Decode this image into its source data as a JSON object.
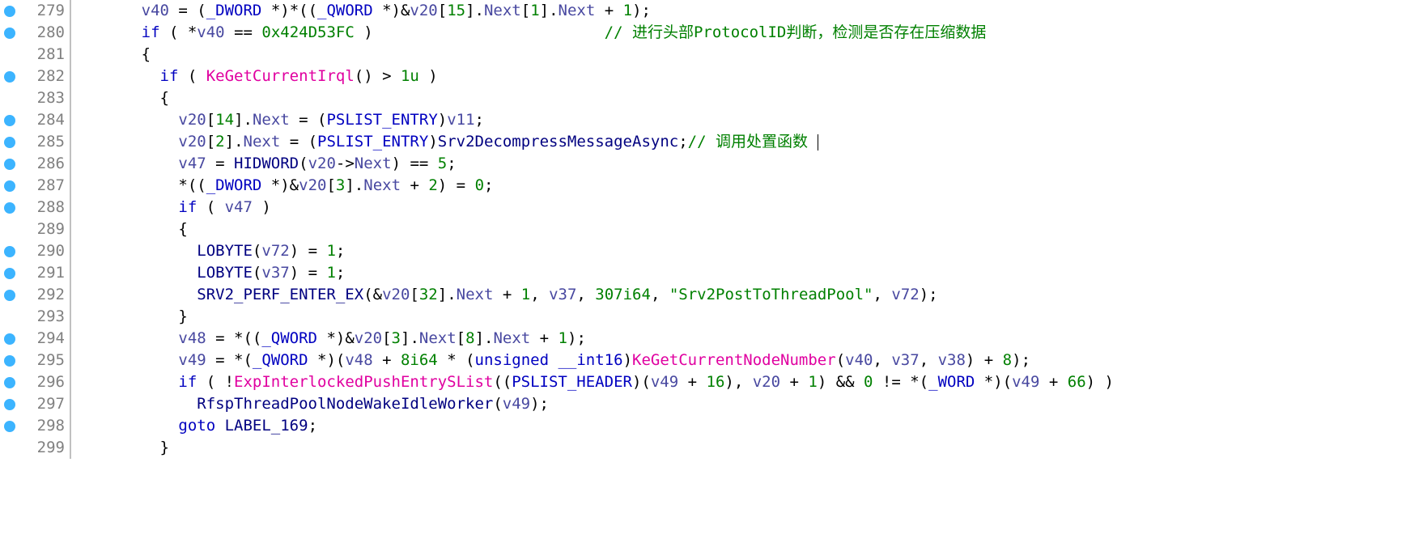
{
  "lines": [
    {
      "n": 279,
      "bp": true,
      "indent": 3,
      "segments": [
        {
          "c": "c-var",
          "t": "v40"
        },
        {
          "c": "c-plain",
          "t": " = ("
        },
        {
          "c": "c-type",
          "t": "_DWORD"
        },
        {
          "c": "c-plain",
          "t": " *)*(("
        },
        {
          "c": "c-type",
          "t": "_QWORD"
        },
        {
          "c": "c-plain",
          "t": " *)&"
        },
        {
          "c": "c-var",
          "t": "v20"
        },
        {
          "c": "c-plain",
          "t": "["
        },
        {
          "c": "c-num",
          "t": "15"
        },
        {
          "c": "c-plain",
          "t": "]."
        },
        {
          "c": "c-member",
          "t": "Next"
        },
        {
          "c": "c-plain",
          "t": "["
        },
        {
          "c": "c-num",
          "t": "1"
        },
        {
          "c": "c-plain",
          "t": "]."
        },
        {
          "c": "c-member",
          "t": "Next"
        },
        {
          "c": "c-plain",
          "t": " + "
        },
        {
          "c": "c-num",
          "t": "1"
        },
        {
          "c": "c-plain",
          "t": ");"
        }
      ]
    },
    {
      "n": 280,
      "bp": true,
      "indent": 3,
      "segments": [
        {
          "c": "c-kw",
          "t": "if"
        },
        {
          "c": "c-plain",
          "t": " ( *"
        },
        {
          "c": "c-var",
          "t": "v40"
        },
        {
          "c": "c-plain",
          "t": " == "
        },
        {
          "c": "c-num",
          "t": "0x424D53FC"
        },
        {
          "c": "c-plain",
          "t": " )                         "
        },
        {
          "c": "c-cmt",
          "t": "// 进行头部ProtocolID判断，检测是否存在压缩数据"
        }
      ]
    },
    {
      "n": 281,
      "bp": false,
      "indent": 3,
      "segments": [
        {
          "c": "c-plain",
          "t": "{"
        }
      ]
    },
    {
      "n": 282,
      "bp": true,
      "indent": 4,
      "segments": [
        {
          "c": "c-kw",
          "t": "if"
        },
        {
          "c": "c-plain",
          "t": " ( "
        },
        {
          "c": "c-lib",
          "t": "KeGetCurrentIrql"
        },
        {
          "c": "c-plain",
          "t": "() > "
        },
        {
          "c": "c-num",
          "t": "1u"
        },
        {
          "c": "c-plain",
          "t": " )"
        }
      ]
    },
    {
      "n": 283,
      "bp": false,
      "indent": 4,
      "segments": [
        {
          "c": "c-plain",
          "t": "{"
        }
      ]
    },
    {
      "n": 284,
      "bp": true,
      "indent": 5,
      "segments": [
        {
          "c": "c-var",
          "t": "v20"
        },
        {
          "c": "c-plain",
          "t": "["
        },
        {
          "c": "c-num",
          "t": "14"
        },
        {
          "c": "c-plain",
          "t": "]."
        },
        {
          "c": "c-member",
          "t": "Next"
        },
        {
          "c": "c-plain",
          "t": " = ("
        },
        {
          "c": "c-type",
          "t": "PSLIST_ENTRY"
        },
        {
          "c": "c-plain",
          "t": ")"
        },
        {
          "c": "c-var",
          "t": "v11"
        },
        {
          "c": "c-plain",
          "t": ";"
        }
      ]
    },
    {
      "n": 285,
      "bp": true,
      "indent": 5,
      "segments": [
        {
          "c": "c-var",
          "t": "v20"
        },
        {
          "c": "c-plain",
          "t": "["
        },
        {
          "c": "c-num",
          "t": "2"
        },
        {
          "c": "c-plain",
          "t": "]."
        },
        {
          "c": "c-member",
          "t": "Next"
        },
        {
          "c": "c-plain",
          "t": " = ("
        },
        {
          "c": "c-type",
          "t": "PSLIST_ENTRY"
        },
        {
          "c": "c-plain",
          "t": ")"
        },
        {
          "c": "c-func",
          "t": "Srv2DecompressMessageAsync"
        },
        {
          "c": "c-plain",
          "t": ";"
        },
        {
          "c": "c-cmt",
          "t": "// 调用处置函数 "
        },
        {
          "c": "cursor",
          "t": ""
        }
      ]
    },
    {
      "n": 286,
      "bp": true,
      "indent": 5,
      "segments": [
        {
          "c": "c-var",
          "t": "v47"
        },
        {
          "c": "c-plain",
          "t": " = "
        },
        {
          "c": "c-func",
          "t": "HIDWORD"
        },
        {
          "c": "c-plain",
          "t": "("
        },
        {
          "c": "c-var",
          "t": "v20"
        },
        {
          "c": "c-plain",
          "t": "->"
        },
        {
          "c": "c-member",
          "t": "Next"
        },
        {
          "c": "c-plain",
          "t": ") == "
        },
        {
          "c": "c-num",
          "t": "5"
        },
        {
          "c": "c-plain",
          "t": ";"
        }
      ]
    },
    {
      "n": 287,
      "bp": true,
      "indent": 5,
      "segments": [
        {
          "c": "c-plain",
          "t": "*(("
        },
        {
          "c": "c-type",
          "t": "_DWORD"
        },
        {
          "c": "c-plain",
          "t": " *)&"
        },
        {
          "c": "c-var",
          "t": "v20"
        },
        {
          "c": "c-plain",
          "t": "["
        },
        {
          "c": "c-num",
          "t": "3"
        },
        {
          "c": "c-plain",
          "t": "]."
        },
        {
          "c": "c-member",
          "t": "Next"
        },
        {
          "c": "c-plain",
          "t": " + "
        },
        {
          "c": "c-num",
          "t": "2"
        },
        {
          "c": "c-plain",
          "t": ") = "
        },
        {
          "c": "c-num",
          "t": "0"
        },
        {
          "c": "c-plain",
          "t": ";"
        }
      ]
    },
    {
      "n": 288,
      "bp": true,
      "indent": 5,
      "segments": [
        {
          "c": "c-kw",
          "t": "if"
        },
        {
          "c": "c-plain",
          "t": " ( "
        },
        {
          "c": "c-var",
          "t": "v47"
        },
        {
          "c": "c-plain",
          "t": " )"
        }
      ]
    },
    {
      "n": 289,
      "bp": false,
      "indent": 5,
      "segments": [
        {
          "c": "c-plain",
          "t": "{"
        }
      ]
    },
    {
      "n": 290,
      "bp": true,
      "indent": 6,
      "segments": [
        {
          "c": "c-func",
          "t": "LOBYTE"
        },
        {
          "c": "c-plain",
          "t": "("
        },
        {
          "c": "c-var",
          "t": "v72"
        },
        {
          "c": "c-plain",
          "t": ") = "
        },
        {
          "c": "c-num",
          "t": "1"
        },
        {
          "c": "c-plain",
          "t": ";"
        }
      ]
    },
    {
      "n": 291,
      "bp": true,
      "indent": 6,
      "segments": [
        {
          "c": "c-func",
          "t": "LOBYTE"
        },
        {
          "c": "c-plain",
          "t": "("
        },
        {
          "c": "c-var",
          "t": "v37"
        },
        {
          "c": "c-plain",
          "t": ") = "
        },
        {
          "c": "c-num",
          "t": "1"
        },
        {
          "c": "c-plain",
          "t": ";"
        }
      ]
    },
    {
      "n": 292,
      "bp": true,
      "indent": 6,
      "segments": [
        {
          "c": "c-func",
          "t": "SRV2_PERF_ENTER_EX"
        },
        {
          "c": "c-plain",
          "t": "(&"
        },
        {
          "c": "c-var",
          "t": "v20"
        },
        {
          "c": "c-plain",
          "t": "["
        },
        {
          "c": "c-num",
          "t": "32"
        },
        {
          "c": "c-plain",
          "t": "]."
        },
        {
          "c": "c-member",
          "t": "Next"
        },
        {
          "c": "c-plain",
          "t": " + "
        },
        {
          "c": "c-num",
          "t": "1"
        },
        {
          "c": "c-plain",
          "t": ", "
        },
        {
          "c": "c-var",
          "t": "v37"
        },
        {
          "c": "c-plain",
          "t": ", "
        },
        {
          "c": "c-num",
          "t": "307i64"
        },
        {
          "c": "c-plain",
          "t": ", "
        },
        {
          "c": "c-str",
          "t": "\"Srv2PostToThreadPool\""
        },
        {
          "c": "c-plain",
          "t": ", "
        },
        {
          "c": "c-var",
          "t": "v72"
        },
        {
          "c": "c-plain",
          "t": ");"
        }
      ]
    },
    {
      "n": 293,
      "bp": false,
      "indent": 5,
      "segments": [
        {
          "c": "c-plain",
          "t": "}"
        }
      ]
    },
    {
      "n": 294,
      "bp": true,
      "indent": 5,
      "segments": [
        {
          "c": "c-var",
          "t": "v48"
        },
        {
          "c": "c-plain",
          "t": " = *(("
        },
        {
          "c": "c-type",
          "t": "_QWORD"
        },
        {
          "c": "c-plain",
          "t": " *)&"
        },
        {
          "c": "c-var",
          "t": "v20"
        },
        {
          "c": "c-plain",
          "t": "["
        },
        {
          "c": "c-num",
          "t": "3"
        },
        {
          "c": "c-plain",
          "t": "]."
        },
        {
          "c": "c-member",
          "t": "Next"
        },
        {
          "c": "c-plain",
          "t": "["
        },
        {
          "c": "c-num",
          "t": "8"
        },
        {
          "c": "c-plain",
          "t": "]."
        },
        {
          "c": "c-member",
          "t": "Next"
        },
        {
          "c": "c-plain",
          "t": " + "
        },
        {
          "c": "c-num",
          "t": "1"
        },
        {
          "c": "c-plain",
          "t": ");"
        }
      ]
    },
    {
      "n": 295,
      "bp": true,
      "indent": 5,
      "segments": [
        {
          "c": "c-var",
          "t": "v49"
        },
        {
          "c": "c-plain",
          "t": " = *("
        },
        {
          "c": "c-type",
          "t": "_QWORD"
        },
        {
          "c": "c-plain",
          "t": " *)("
        },
        {
          "c": "c-var",
          "t": "v48"
        },
        {
          "c": "c-plain",
          "t": " + "
        },
        {
          "c": "c-num",
          "t": "8i64"
        },
        {
          "c": "c-plain",
          "t": " * ("
        },
        {
          "c": "c-kw",
          "t": "unsigned"
        },
        {
          "c": "c-plain",
          "t": " "
        },
        {
          "c": "c-kw",
          "t": "__int16"
        },
        {
          "c": "c-plain",
          "t": ")"
        },
        {
          "c": "c-lib",
          "t": "KeGetCurrentNodeNumber"
        },
        {
          "c": "c-plain",
          "t": "("
        },
        {
          "c": "c-var",
          "t": "v40"
        },
        {
          "c": "c-plain",
          "t": ", "
        },
        {
          "c": "c-var",
          "t": "v37"
        },
        {
          "c": "c-plain",
          "t": ", "
        },
        {
          "c": "c-var",
          "t": "v38"
        },
        {
          "c": "c-plain",
          "t": ") + "
        },
        {
          "c": "c-num",
          "t": "8"
        },
        {
          "c": "c-plain",
          "t": ");"
        }
      ]
    },
    {
      "n": 296,
      "bp": true,
      "indent": 5,
      "segments": [
        {
          "c": "c-kw",
          "t": "if"
        },
        {
          "c": "c-plain",
          "t": " ( !"
        },
        {
          "c": "c-lib",
          "t": "ExpInterlockedPushEntrySList"
        },
        {
          "c": "c-plain",
          "t": "(("
        },
        {
          "c": "c-type",
          "t": "PSLIST_HEADER"
        },
        {
          "c": "c-plain",
          "t": ")("
        },
        {
          "c": "c-var",
          "t": "v49"
        },
        {
          "c": "c-plain",
          "t": " + "
        },
        {
          "c": "c-num",
          "t": "16"
        },
        {
          "c": "c-plain",
          "t": "), "
        },
        {
          "c": "c-var",
          "t": "v20"
        },
        {
          "c": "c-plain",
          "t": " + "
        },
        {
          "c": "c-num",
          "t": "1"
        },
        {
          "c": "c-plain",
          "t": ") && "
        },
        {
          "c": "c-num",
          "t": "0"
        },
        {
          "c": "c-plain",
          "t": " != *("
        },
        {
          "c": "c-type",
          "t": "_WORD"
        },
        {
          "c": "c-plain",
          "t": " *)("
        },
        {
          "c": "c-var",
          "t": "v49"
        },
        {
          "c": "c-plain",
          "t": " + "
        },
        {
          "c": "c-num",
          "t": "66"
        },
        {
          "c": "c-plain",
          "t": ") )"
        }
      ]
    },
    {
      "n": 297,
      "bp": true,
      "indent": 6,
      "segments": [
        {
          "c": "c-func",
          "t": "RfspThreadPoolNodeWakeIdleWorker"
        },
        {
          "c": "c-plain",
          "t": "("
        },
        {
          "c": "c-var",
          "t": "v49"
        },
        {
          "c": "c-plain",
          "t": ");"
        }
      ]
    },
    {
      "n": 298,
      "bp": true,
      "indent": 5,
      "segments": [
        {
          "c": "c-kw",
          "t": "goto"
        },
        {
          "c": "c-plain",
          "t": " "
        },
        {
          "c": "c-label",
          "t": "LABEL_169"
        },
        {
          "c": "c-plain",
          "t": ";"
        }
      ]
    },
    {
      "n": 299,
      "bp": false,
      "indent": 4,
      "segments": [
        {
          "c": "c-plain",
          "t": "}"
        }
      ]
    }
  ],
  "indentUnit": "  "
}
